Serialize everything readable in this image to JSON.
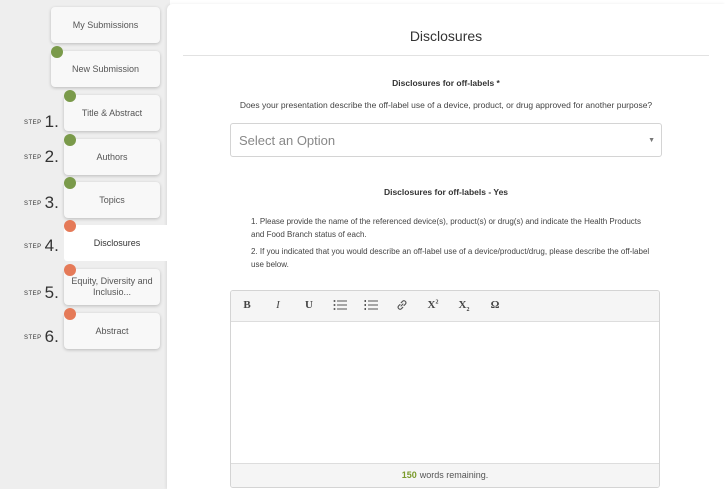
{
  "sidebar": {
    "items": [
      {
        "label": "My Submissions",
        "step": "",
        "state": "done"
      },
      {
        "label": "New Submission",
        "step": "",
        "state": "done"
      },
      {
        "label": "Title & Abstract",
        "step": "1.",
        "state": "done"
      },
      {
        "label": "Authors",
        "step": "2.",
        "state": "done"
      },
      {
        "label": "Topics",
        "step": "3.",
        "state": "done"
      },
      {
        "label": "Disclosures",
        "step": "4.",
        "state": "active"
      },
      {
        "label": "Equity, Diversity and Inclusio...",
        "step": "5.",
        "state": "pending"
      },
      {
        "label": "Abstract",
        "step": "6.",
        "state": "pending"
      }
    ],
    "step_word": "STEP"
  },
  "main": {
    "title": "Disclosures",
    "section1": {
      "heading": "Disclosures for off-labels *",
      "question": "Does your presentation describe the off-label use of a device, product, or drug approved for another purpose?",
      "select_value": "Select an Option"
    },
    "section2": {
      "heading": "Disclosures for off-labels - Yes",
      "instructions": [
        "1. Please provide the name of the referenced device(s), product(s) or drug(s) and indicate the Health Products and Food Branch status of each.",
        "2. If you indicated that you would describe an off-label use of a device/product/drug, please describe the off-label use below."
      ]
    },
    "editor": {
      "toolbar": [
        "B",
        "I",
        "U",
        "☰",
        "☰",
        "🔗",
        "X²",
        "X₂",
        "Ω"
      ],
      "words_remaining": "150",
      "words_remaining_suffix": "words remaining."
    }
  },
  "colors": {
    "done": "#7a9a4a",
    "pending": "#e57a58",
    "count": "#7a9a2a"
  }
}
